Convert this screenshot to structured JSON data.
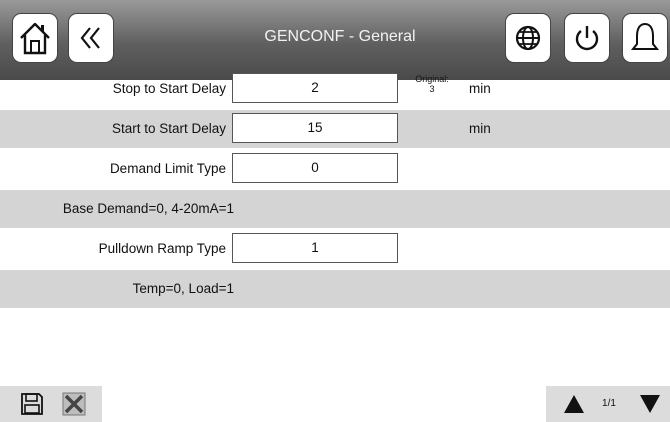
{
  "header": {
    "title": "GENCONF - General"
  },
  "rows": [
    {
      "label": "Stop to Start Delay",
      "value": "2",
      "original_label": "Original:",
      "original_value": "3",
      "unit": "min"
    },
    {
      "label": "Start to Start Delay",
      "value": "15",
      "unit": "min"
    },
    {
      "label": "Demand Limit Type",
      "value": "0"
    },
    {
      "note": "Base Demand=0, 4-20mA=1"
    },
    {
      "label": "Pulldown Ramp Type",
      "value": "1"
    },
    {
      "note": "Temp=0, Load=1"
    }
  ],
  "footer": {
    "page": "1/1"
  },
  "icons": {
    "home": "home-icon",
    "back": "back-icon",
    "globe": "globe-icon",
    "power": "power-icon",
    "bell": "bell-icon",
    "save": "save-icon",
    "cancel": "cancel-icon",
    "up": "up-arrow-icon",
    "down": "down-arrow-icon"
  }
}
